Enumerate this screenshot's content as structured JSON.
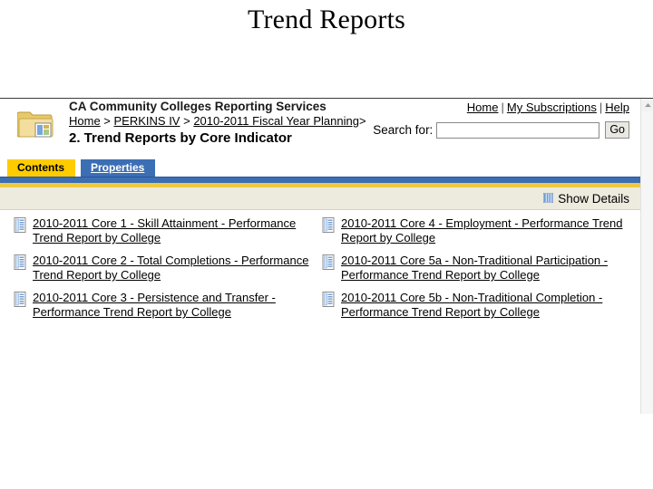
{
  "slide": {
    "title": "Trend Reports"
  },
  "app": {
    "title": "CA Community Colleges Reporting Services",
    "page_heading": "2. Trend Reports by Core Indicator"
  },
  "breadcrumb": {
    "items": [
      "Home",
      "PERKINS IV",
      "2010-2011 Fiscal Year Planning"
    ],
    "separator": ">",
    "trailing": ">"
  },
  "topnav": {
    "items": [
      "Home",
      "My Subscriptions",
      "Help"
    ],
    "separator": "|"
  },
  "search": {
    "label": "Search for:",
    "value": "",
    "placeholder": "",
    "button_label": "Go"
  },
  "tabs": [
    {
      "label": "Contents",
      "active": true
    },
    {
      "label": "Properties",
      "active": false
    }
  ],
  "toolbar": {
    "show_details_label": "Show Details",
    "show_details_icon": "grid-icon"
  },
  "icons": {
    "folder": "folder-report-icon",
    "document": "report-document-icon",
    "scroll_up": "scroll-up-arrow-icon"
  },
  "colors": {
    "tab_active_bg": "#FFCC00",
    "tab_inactive_bg": "#3C6EB4",
    "band_blue": "#3C6EB4",
    "band_gold": "#EFC93F",
    "toolbar_bg": "#EDEBDE",
    "link": "#000000"
  },
  "reports": {
    "left_column": [
      "2010-2011 Core 1 - Skill Attainment - Performance Trend Report by College",
      "2010-2011 Core 2 - Total Completions - Performance Trend Report by College",
      "2010-2011 Core 3 - Persistence and Transfer - Performance Trend Report by College"
    ],
    "right_column": [
      "2010-2011 Core 4 - Employment - Performance Trend Report by College",
      "2010-2011 Core 5a - Non-Traditional Participation - Performance Trend Report by College",
      "2010-2011 Core 5b - Non-Traditional Completion - Performance Trend Report by College"
    ]
  }
}
